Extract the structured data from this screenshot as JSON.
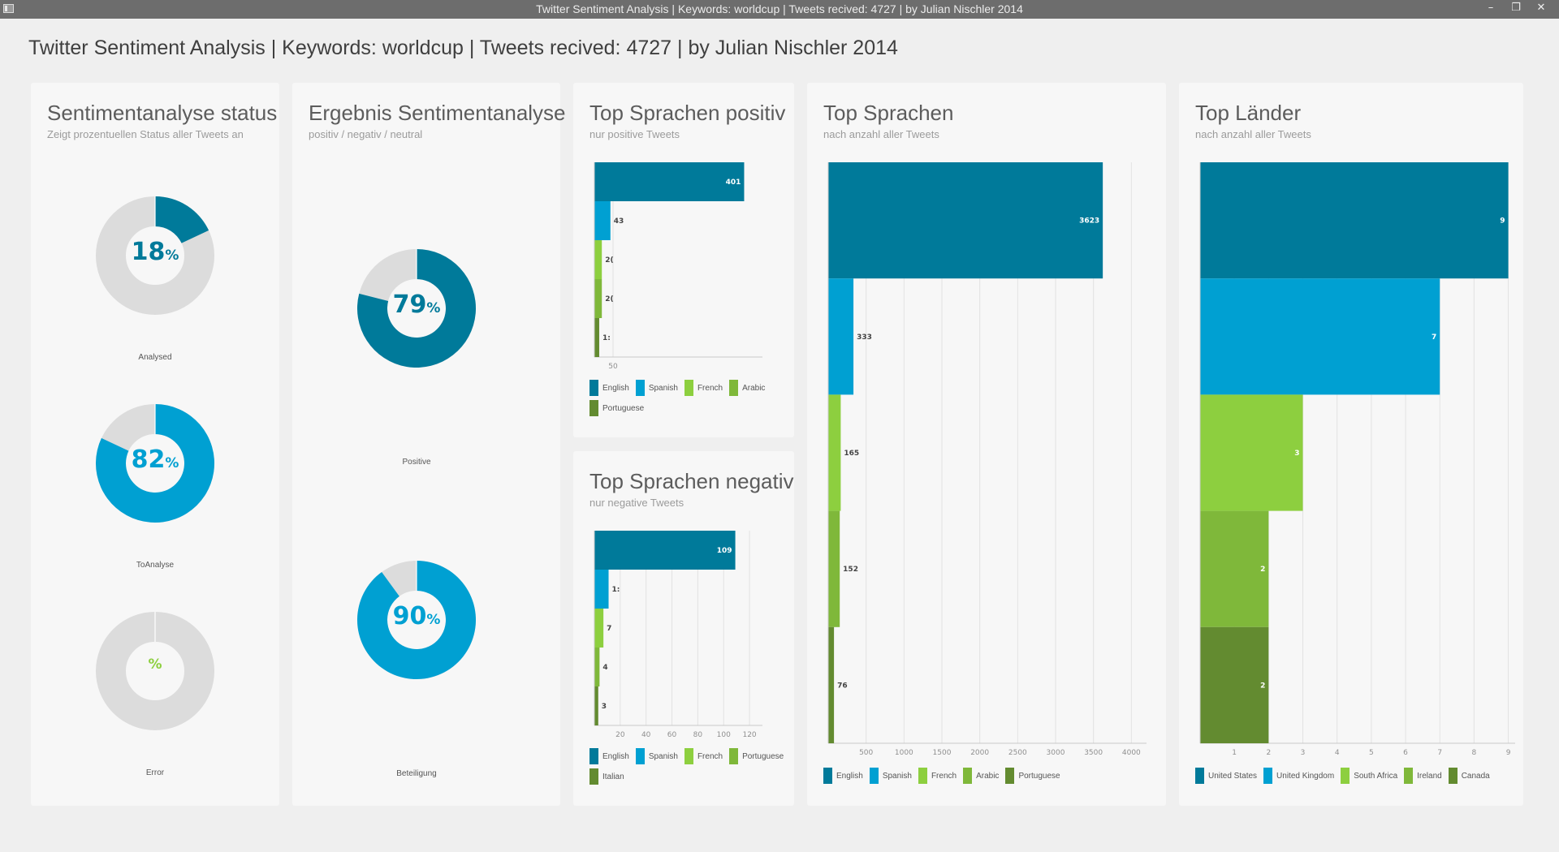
{
  "window": {
    "title": "Twitter Sentiment Analysis | Keywords: worldcup | Tweets recived: 4727 | by Julian Nischler 2014",
    "minimize": "–",
    "restore": "❐",
    "close": "✕"
  },
  "header": {
    "title": "Twitter Sentiment Analysis | Keywords: worldcup | Tweets recived: 4727 | by Julian Nischler 2014"
  },
  "colors": {
    "teal_dark": "#007a9a",
    "blue": "#00a0d2",
    "green_light": "#8dcf3f",
    "green_mid": "#7fb83a",
    "green_dark": "#638b30",
    "ring_bg": "#dcdcdc"
  },
  "status_panel": {
    "title": "Sentimentanalyse status",
    "subtitle": "Zeigt prozentuellen Status aller Tweets an",
    "donuts": [
      {
        "value": 18,
        "value_text": "18",
        "unit": "%",
        "caption": "Analysed",
        "color": "#007a9a"
      },
      {
        "value": 82,
        "value_text": "82",
        "unit": "%",
        "caption": "ToAnalyse",
        "color": "#00a0d2"
      },
      {
        "value": 0,
        "value_text": "",
        "unit": "%",
        "caption": "Error",
        "color": "#8dcf3f"
      }
    ]
  },
  "result_panel": {
    "title": "Ergebnis Sentimentanalyse",
    "subtitle": "positiv / negativ / neutral",
    "donuts": [
      {
        "value": 79,
        "value_text": "79",
        "unit": "%",
        "caption": "Positive",
        "color": "#007a9a"
      },
      {
        "value": 90,
        "value_text": "90",
        "unit": "%",
        "caption": "Beteiligung",
        "color": "#00a0d2"
      }
    ]
  },
  "pos_panel": {
    "title": "Top Sprachen positiv",
    "subtitle": "nur positive Tweets"
  },
  "neg_panel": {
    "title": "Top Sprachen negativ",
    "subtitle": "nur negative Tweets"
  },
  "lang_panel": {
    "title": "Top Sprachen",
    "subtitle": "nach anzahl aller Tweets"
  },
  "country_panel": {
    "title": "Top Länder",
    "subtitle": "nach anzahl aller Tweets"
  },
  "chart_data": [
    {
      "id": "pos",
      "type": "bar",
      "orientation": "horizontal",
      "title": "Top Sprachen positiv",
      "subtitle": "nur positive Tweets",
      "categories": [
        "English",
        "Spanish",
        "French",
        "Arabic",
        "Portuguese"
      ],
      "values": [
        401,
        43,
        20,
        20,
        13
      ],
      "value_labels": [
        "401",
        "43",
        "2(",
        "2(",
        "1:"
      ],
      "colors": [
        "#007a9a",
        "#00a0d2",
        "#8dcf3f",
        "#7fb83a",
        "#638b30"
      ],
      "xlim": [
        0,
        450
      ],
      "ticks": [
        50
      ],
      "tick_labels": [
        "50"
      ],
      "legend": [
        "English",
        "Spanish",
        "French",
        "Arabic",
        "Portuguese"
      ]
    },
    {
      "id": "neg",
      "type": "bar",
      "orientation": "horizontal",
      "title": "Top Sprachen negativ",
      "subtitle": "nur negative Tweets",
      "categories": [
        "English",
        "Spanish",
        "French",
        "Portuguese",
        "Italian"
      ],
      "values": [
        109,
        11,
        7,
        4,
        3
      ],
      "value_labels": [
        "109",
        "1:",
        "7",
        "4",
        "3"
      ],
      "colors": [
        "#007a9a",
        "#00a0d2",
        "#8dcf3f",
        "#7fb83a",
        "#638b30"
      ],
      "xlim": [
        0,
        130
      ],
      "ticks": [
        20,
        40,
        60,
        80,
        100,
        120
      ],
      "tick_labels": [
        "20",
        "40",
        "60",
        "80",
        "100",
        "120"
      ],
      "legend": [
        "English",
        "Spanish",
        "French",
        "Portuguese",
        "Italian"
      ]
    },
    {
      "id": "lang",
      "type": "bar",
      "orientation": "horizontal",
      "title": "Top Sprachen",
      "subtitle": "nach anzahl aller Tweets",
      "categories": [
        "English",
        "Spanish",
        "French",
        "Arabic",
        "Portuguese"
      ],
      "values": [
        3623,
        333,
        165,
        152,
        76
      ],
      "value_labels": [
        "3623",
        "333",
        "165",
        "152",
        "76"
      ],
      "colors": [
        "#007a9a",
        "#00a0d2",
        "#8dcf3f",
        "#7fb83a",
        "#638b30"
      ],
      "xlim": [
        0,
        4200
      ],
      "ticks": [
        500,
        1000,
        1500,
        2000,
        2500,
        3000,
        3500,
        4000
      ],
      "tick_labels": [
        "500",
        "1000",
        "1500",
        "2000",
        "2500",
        "3000",
        "3500",
        "4000"
      ],
      "legend": [
        "English",
        "Spanish",
        "French",
        "Arabic",
        "Portuguese"
      ]
    },
    {
      "id": "country",
      "type": "bar",
      "orientation": "horizontal",
      "title": "Top Länder",
      "subtitle": "nach anzahl aller Tweets",
      "categories": [
        "United States",
        "United Kingdom",
        "South Africa",
        "Ireland",
        "Canada"
      ],
      "values": [
        9,
        7,
        3,
        2,
        2
      ],
      "value_labels": [
        "9",
        "7",
        "3",
        "2",
        "2"
      ],
      "colors": [
        "#007a9a",
        "#00a0d2",
        "#8dcf3f",
        "#7fb83a",
        "#638b30"
      ],
      "xlim": [
        0,
        9.2
      ],
      "ticks": [
        1,
        2,
        3,
        4,
        5,
        6,
        7,
        8,
        9
      ],
      "tick_labels": [
        "1",
        "2",
        "3",
        "4",
        "5",
        "6",
        "7",
        "8",
        "9"
      ],
      "legend": [
        "United States",
        "United Kingdom",
        "South Africa",
        "Ireland",
        "Canada"
      ]
    }
  ]
}
